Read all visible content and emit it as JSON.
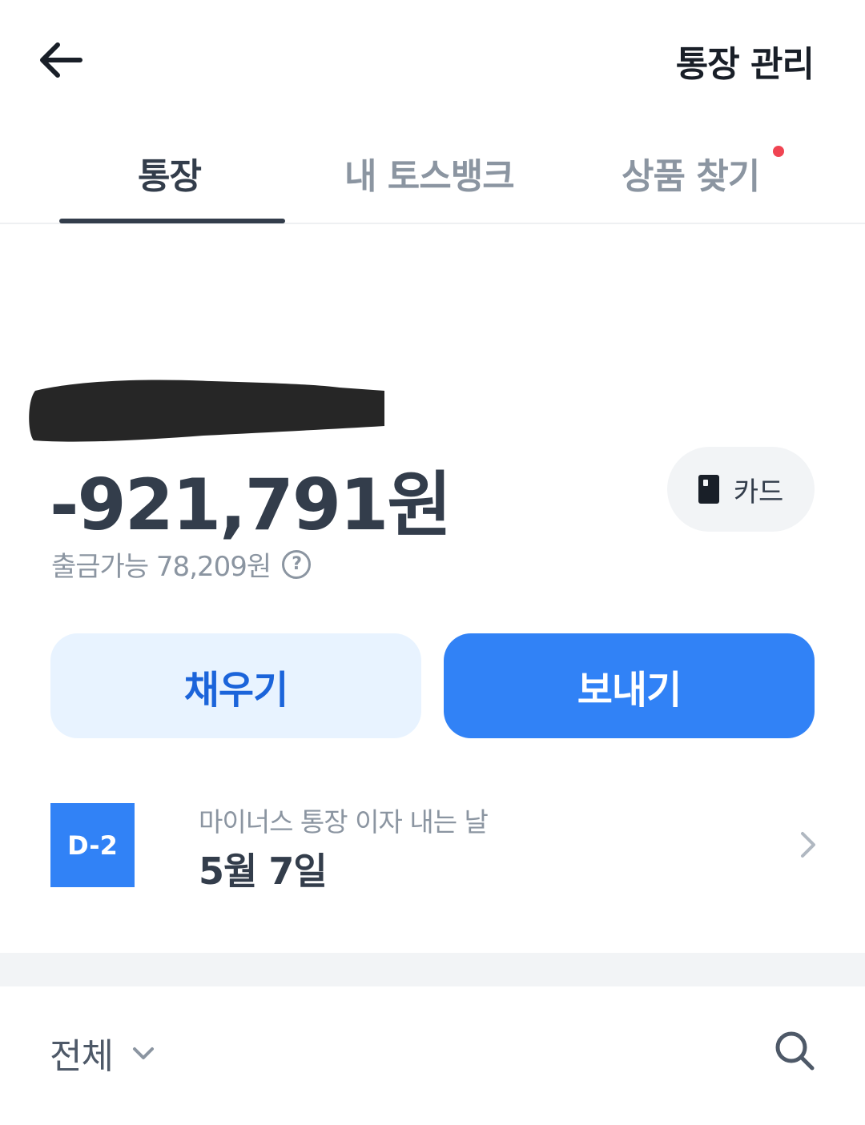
{
  "header": {
    "back_icon": "arrow-left-icon",
    "manage_label": "통장 관리"
  },
  "tabs": [
    {
      "label": "통장",
      "active": true
    },
    {
      "label": "내 토스뱅크",
      "active": false
    },
    {
      "label": "상품 찾기",
      "active": false,
      "has_notification_dot": true
    }
  ],
  "account": {
    "balance": "-921,791원",
    "withdrawable": "출금가능 78,209원",
    "help_icon_glyph": "?",
    "card_button_label": "카드"
  },
  "actions": {
    "fill_label": "채우기",
    "send_label": "보내기"
  },
  "interest": {
    "dday": "D-2",
    "label": "마이너스 통장 이자 내는 날",
    "date": "5월 7일"
  },
  "filter": {
    "label": "전체"
  },
  "colors": {
    "primary": "#3182f6",
    "primary_light": "#e8f3ff",
    "text_dark": "#333d4b",
    "text_gray": "#8b95a1",
    "notification": "#f04452"
  }
}
